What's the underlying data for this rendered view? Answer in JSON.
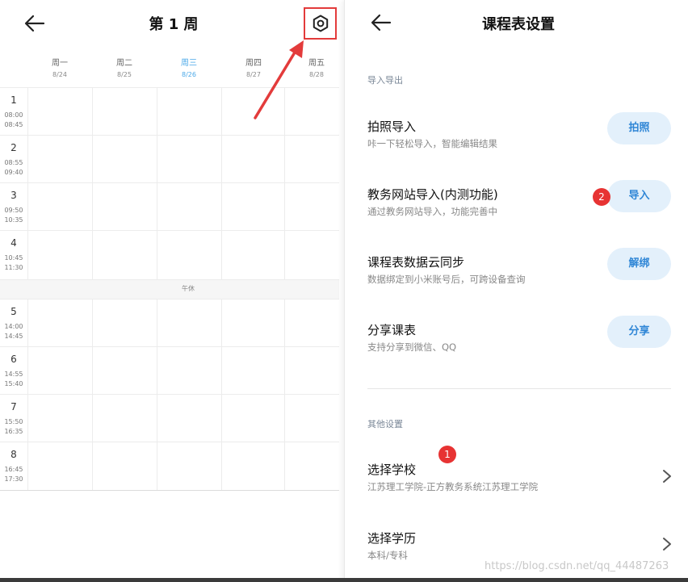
{
  "timetable": {
    "week_title": "第 1 周",
    "days": [
      {
        "name": "周一",
        "date": "8/24"
      },
      {
        "name": "周二",
        "date": "8/25"
      },
      {
        "name": "周三",
        "date": "8/26"
      },
      {
        "name": "周四",
        "date": "8/27"
      },
      {
        "name": "周五",
        "date": "8/28"
      }
    ],
    "today_color": "#4aa8e8",
    "periods": [
      {
        "num": "1",
        "start": "08:00",
        "end": "08:45"
      },
      {
        "num": "2",
        "start": "08:55",
        "end": "09:40"
      },
      {
        "num": "3",
        "start": "09:50",
        "end": "10:35"
      },
      {
        "num": "4",
        "start": "10:45",
        "end": "11:30"
      },
      {
        "num": "5",
        "start": "14:00",
        "end": "14:45"
      },
      {
        "num": "6",
        "start": "14:55",
        "end": "15:40"
      },
      {
        "num": "7",
        "start": "15:50",
        "end": "16:35"
      },
      {
        "num": "8",
        "start": "16:45",
        "end": "17:30"
      }
    ],
    "noon_label": "午休"
  },
  "settings": {
    "title": "课程表设置",
    "import_section": "导入导出",
    "rows": [
      {
        "title": "拍照导入",
        "subtitle": "咔一下轻松导入，智能编辑结果",
        "button": "拍照"
      },
      {
        "title": "教务网站导入(内测功能)",
        "subtitle": "通过教务网站导入，功能完善中",
        "button": "导入"
      },
      {
        "title": "课程表数据云同步",
        "subtitle": "数据绑定到小米账号后，可跨设备查询",
        "button": "解绑"
      },
      {
        "title": "分享课表",
        "subtitle": "支持分享到微信、QQ",
        "button": "分享"
      }
    ],
    "other_section": "其他设置",
    "school": {
      "title": "选择学校",
      "subtitle": "江苏理工学院-正方教务系统江苏理工学院"
    },
    "education": {
      "title": "选择学历",
      "subtitle": "本科/专科"
    },
    "accent_color": "#2f86d6",
    "pill_color": "#e3f0fb"
  },
  "annotations": {
    "badge_1": "1",
    "badge_2": "2",
    "highlight_color": "#e33b3b"
  },
  "watermark": "https://blog.csdn.net/qq_44487263"
}
